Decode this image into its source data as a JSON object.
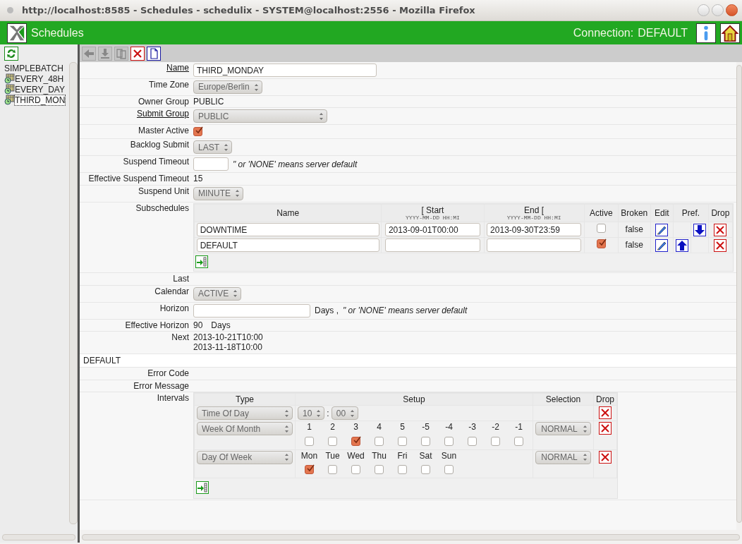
{
  "window": {
    "title": "http://localhost:8585 - Schedules - schedulix - SYSTEM@localhost:2556 - Mozilla Firefox"
  },
  "app_bar": {
    "title": "Schedules",
    "connection_label": "Connection:",
    "connection": "DEFAULT"
  },
  "sidebar": {
    "header": "SIMPLEBATCH",
    "items": [
      {
        "label": "EVERY_48H",
        "selected": false
      },
      {
        "label": "EVERY_DAY",
        "selected": false
      },
      {
        "label": "THIRD_MON",
        "selected": true
      }
    ]
  },
  "toolbar": [
    {
      "kind": "back",
      "disabled": true
    },
    {
      "kind": "save",
      "disabled": true
    },
    {
      "kind": "copy",
      "disabled": true
    },
    {
      "kind": "delete",
      "disabled": false
    },
    {
      "kind": "new",
      "disabled": false
    }
  ],
  "form": [
    {
      "kind": "input",
      "label": "Name",
      "link": true,
      "value": "THIRD_MONDAY"
    },
    {
      "kind": "select",
      "label": "Time Zone",
      "link": false,
      "value": "Europe/Berlin"
    },
    {
      "kind": "text",
      "label": "Owner Group",
      "link": false,
      "value": "PUBLIC"
    },
    {
      "kind": "select",
      "label": "Submit Group",
      "link": true,
      "value": "PUBLIC"
    },
    {
      "kind": "checkbox",
      "label": "Master Active",
      "link": false,
      "checked": true
    },
    {
      "kind": "select",
      "label": "Backlog Submit",
      "link": false,
      "value": "LAST"
    },
    {
      "kind": "input",
      "label": "Suspend Timeout",
      "hint": "\" or 'NONE' means server default"
    },
    {
      "kind": "text",
      "label": "Effective Suspend Timeout",
      "link": false,
      "value": "15"
    },
    {
      "kind": "select",
      "label": "Suspend Unit",
      "link": false,
      "value": "MINUTE"
    },
    {
      "kind": "subschedules",
      "label": "Subschedules",
      "link": false
    },
    {
      "kind": "text",
      "label": "Last",
      "link": false
    },
    {
      "kind": "select",
      "label": "Calendar",
      "link": false,
      "value": "ACTIVE"
    },
    {
      "kind": "input",
      "label": "Horizon",
      "suffix": "Days ,",
      "hint": "\" or 'NONE' means server default"
    },
    {
      "kind": "text",
      "label": "Effective Horizon",
      "link": false,
      "value": "90",
      "suffix": "Days"
    },
    {
      "kind": "lines",
      "label": "Next",
      "link": false,
      "lines": [
        "2013-10-21T10:00",
        "2013-11-18T10:00"
      ]
    },
    {
      "kind": "section",
      "label": "DEFAULT"
    },
    {
      "kind": "text",
      "label": "Error Code",
      "link": false
    },
    {
      "kind": "text",
      "label": "Error Message",
      "link": false
    },
    {
      "kind": "intervals",
      "label": "Intervals",
      "link": false
    }
  ],
  "subschedules": {
    "columns": [
      {
        "label": "Name"
      },
      {
        "label": "[ Start",
        "format": "YYYY-MM-DD HH:MI"
      },
      {
        "label": "End [",
        "format": "YYYY-MM-DD HH:MI"
      },
      {
        "label": "Active"
      },
      {
        "label": "Broken"
      },
      {
        "label": "Edit"
      },
      {
        "label": "Pref."
      },
      {
        "label": "Drop"
      }
    ],
    "rows": [
      {
        "name": "DOWNTIME",
        "start": "2013-09-01T00:00",
        "end": "2013-09-30T23:59",
        "active": false,
        "broken": "false",
        "move_up": false,
        "move_down": true
      },
      {
        "name": "DEFAULT",
        "start": "",
        "end": "",
        "active": true,
        "broken": "false",
        "move_up": true,
        "move_down": false
      }
    ]
  },
  "intervals": {
    "columns": [
      "Type",
      "Setup",
      "Selection",
      "Drop"
    ],
    "rows": [
      {
        "kind": "time",
        "type": "Time Of Day",
        "hour": "10",
        "separator": ":",
        "minute": "00"
      },
      {
        "kind": "checks",
        "type": "Week Of Month",
        "selection": "NORMAL",
        "options": [
          {
            "label": "1",
            "checked": false
          },
          {
            "label": "2",
            "checked": false
          },
          {
            "label": "3",
            "checked": true
          },
          {
            "label": "4",
            "checked": false
          },
          {
            "label": "5",
            "checked": false
          },
          {
            "label": "-5",
            "checked": false
          },
          {
            "label": "-4",
            "checked": false
          },
          {
            "label": "-3",
            "checked": false
          },
          {
            "label": "-2",
            "checked": false
          },
          {
            "label": "-1",
            "checked": false
          }
        ]
      },
      {
        "kind": "checks",
        "type": "Day Of Week",
        "selection": "NORMAL",
        "options": [
          {
            "label": "Mon",
            "checked": true
          },
          {
            "label": "Tue",
            "checked": false
          },
          {
            "label": "Wed",
            "checked": false
          },
          {
            "label": "Thu",
            "checked": false
          },
          {
            "label": "Fri",
            "checked": false
          },
          {
            "label": "Sat",
            "checked": false
          },
          {
            "label": "Sun",
            "checked": false
          }
        ]
      }
    ]
  }
}
